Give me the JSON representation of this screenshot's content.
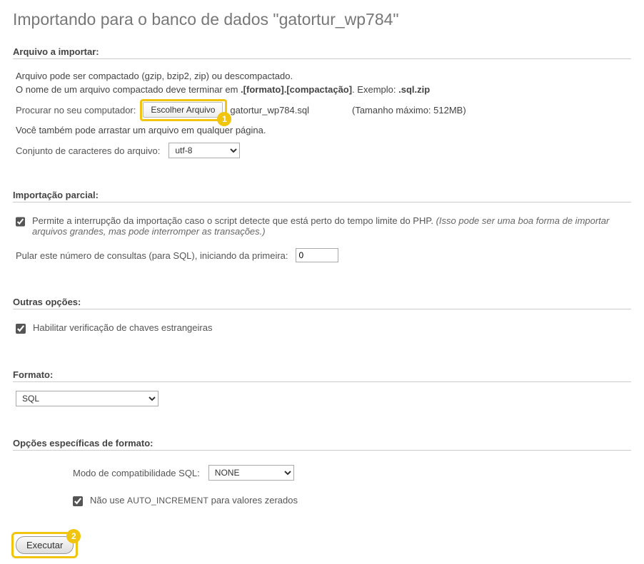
{
  "page_title": "Importando para o banco de dados \"gatortur_wp784\"",
  "file_section": {
    "heading": "Arquivo a importar:",
    "line1": "Arquivo pode ser compactado (gzip, bzip2, zip) ou descompactado.",
    "line2_pre": "O nome de um arquivo compactado deve terminar em ",
    "line2_bold": ".[formato].[compactação]",
    "line2_mid": ". Exemplo: ",
    "line2_example": ".sql.zip",
    "browse_label": "Procurar no seu computador:",
    "choose_button": "Escolher Arquivo",
    "selected_file": "gatortur_wp784.sql",
    "max_size": "(Tamanho máximo: 512MB)",
    "drag_text": "Você também pode arrastar um arquivo em qualquer página.",
    "charset_label": "Conjunto de caracteres do arquivo:",
    "charset_value": "utf-8",
    "badge": "1"
  },
  "partial_section": {
    "heading": "Importação parcial:",
    "allow_pre": "Permite a interrupção da importação caso o script detecte que está perto do tempo limite do PHP. ",
    "allow_italic": "(Isso pode ser uma boa forma de importar arquivos grandes, mas pode interromper as transações.)",
    "skip_label": "Pular este número de consultas (para SQL), iniciando da primeira:",
    "skip_value": "0"
  },
  "other_section": {
    "heading": "Outras opções:",
    "fk_label": "Habilitar verificação de chaves estrangeiras"
  },
  "format_section": {
    "heading": "Formato:",
    "value": "SQL"
  },
  "fopts_section": {
    "heading": "Opções específicas de formato:",
    "compat_label": "Modo de compatibilidade SQL:",
    "compat_value": "NONE",
    "autoinc_pre": "Não use ",
    "autoinc_code": "AUTO_INCREMENT",
    "autoinc_post": " para valores zerados"
  },
  "exec": {
    "label": "Executar",
    "badge": "2"
  }
}
